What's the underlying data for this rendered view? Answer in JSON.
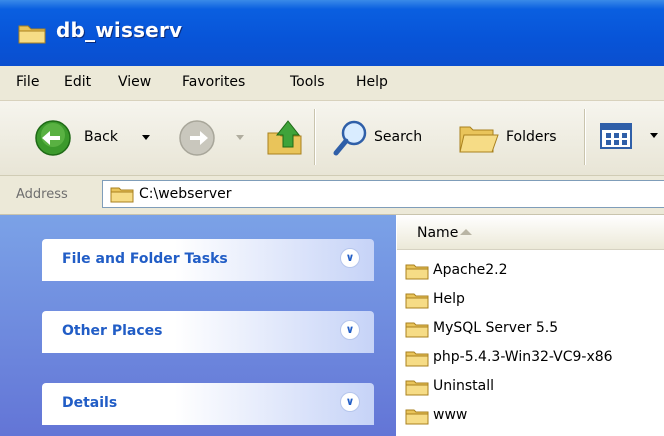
{
  "window": {
    "title": "db_wisserv"
  },
  "menu": [
    "File",
    "Edit",
    "View",
    "Favorites",
    "Tools",
    "Help"
  ],
  "toolbar": {
    "back_label": "Back",
    "search_label": "Search",
    "folders_label": "Folders"
  },
  "address": {
    "label": "Address",
    "path": "C:\\webserver"
  },
  "task_panels": [
    "File and Folder Tasks",
    "Other Places",
    "Details"
  ],
  "filelist": {
    "column_name": "Name",
    "items": [
      "Apache2.2",
      "Help",
      "MySQL Server 5.5",
      "php-5.4.3-Win32-VC9-x86",
      "Uninstall",
      "www"
    ]
  },
  "icons": [
    "folder-icon",
    "back-arrow-icon",
    "forward-arrow-icon",
    "up-folder-icon",
    "search-icon",
    "folders-icon",
    "views-icon",
    "chevron-down-icon"
  ],
  "colors": {
    "titlebar": "#0854d8",
    "taskpane": "#6375d6",
    "panel_label": "#215dc6",
    "chrome": "#ece9d8"
  }
}
